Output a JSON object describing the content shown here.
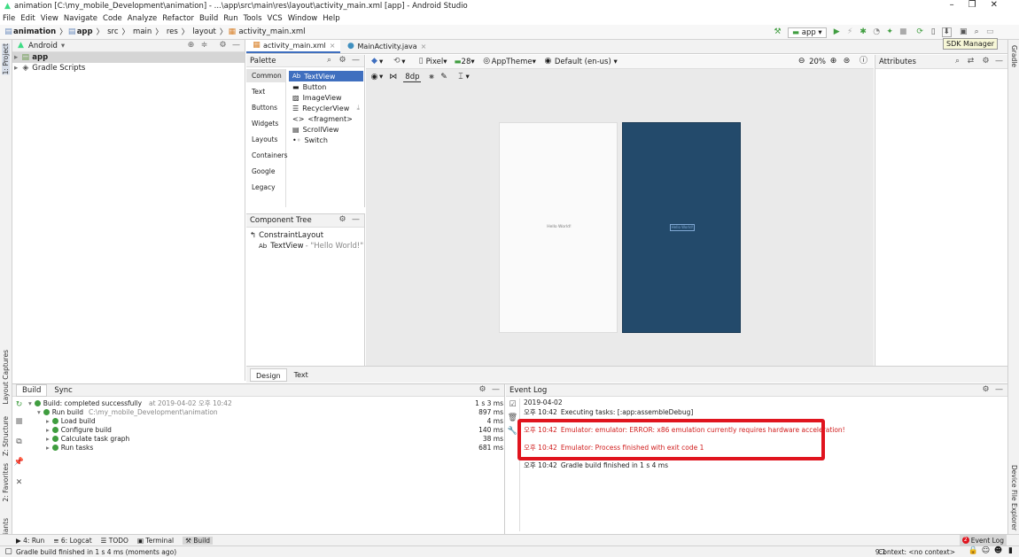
{
  "window": {
    "title": "animation [C:\\my_mobile_Development\\animation] - ...\\app\\src\\main\\res\\layout\\activity_main.xml [app] - Android Studio"
  },
  "menu": [
    "File",
    "Edit",
    "View",
    "Navigate",
    "Code",
    "Analyze",
    "Refactor",
    "Build",
    "Run",
    "Tools",
    "VCS",
    "Window",
    "Help"
  ],
  "breadcrumb": [
    "animation",
    "app",
    "src",
    "main",
    "res",
    "layout",
    "activity_main.xml"
  ],
  "toolbar": {
    "run_config": "app",
    "tooltip": "SDK Manager"
  },
  "project": {
    "view": "Android",
    "items": [
      "app",
      "Gradle Scripts"
    ]
  },
  "editor_tabs": [
    "activity_main.xml",
    "MainActivity.java"
  ],
  "palette": {
    "title": "Palette",
    "categories": [
      "Common",
      "Text",
      "Buttons",
      "Widgets",
      "Layouts",
      "Containers",
      "Google",
      "Legacy"
    ],
    "items": [
      "TextView",
      "Button",
      "ImageView",
      "RecyclerView",
      "<fragment>",
      "ScrollView",
      "Switch"
    ]
  },
  "design_toolbar": {
    "device": "Pixel",
    "api": "28",
    "theme": "AppTheme",
    "locale": "Default (en-us)",
    "zoom": "20%",
    "margin": "8dp"
  },
  "component_tree": {
    "title": "Component Tree",
    "root": "ConstraintLayout",
    "child": "TextView",
    "child_value": "- \"Hello World!\""
  },
  "preview": {
    "text": "Hello World!"
  },
  "attributes": {
    "title": "Attributes"
  },
  "design_tabs": [
    "Design",
    "Text"
  ],
  "build": {
    "tabs": [
      "Build",
      "Sync"
    ],
    "rows": [
      {
        "label": "Build: completed successfully",
        "detail": "at 2019-04-02 오후 10:42",
        "time": "1 s 3 ms"
      },
      {
        "label": "Run build",
        "detail": "C:\\my_mobile_Development\\animation",
        "time": "897 ms"
      },
      {
        "label": "Load build",
        "detail": "",
        "time": "4 ms"
      },
      {
        "label": "Configure build",
        "detail": "",
        "time": "140 ms"
      },
      {
        "label": "Calculate task graph",
        "detail": "",
        "time": "38 ms"
      },
      {
        "label": "Run tasks",
        "detail": "",
        "time": "681 ms"
      }
    ]
  },
  "eventlog": {
    "title": "Event Log",
    "date": "2019-04-02",
    "entries": [
      {
        "time": "오후 10:42",
        "text": "Executing tasks: [:app:assembleDebug]",
        "error": false
      },
      {
        "time": "오후 10:42",
        "text": "Emulator: emulator: ERROR: x86 emulation currently requires hardware acceleration!",
        "error": true
      },
      {
        "time": "오후 10:42",
        "text": "Emulator: Process finished with exit code 1",
        "error": true
      },
      {
        "time": "오후 10:42",
        "text": "Gradle build finished in 1 s 4 ms",
        "error": false
      }
    ]
  },
  "toolwindows": [
    "4: Run",
    "6: Logcat",
    "TODO",
    "Terminal",
    "Build"
  ],
  "eventlog_button": "Event Log",
  "eventlog_badge": "2",
  "side_left": [
    "1: Project",
    "Layout Captures",
    "Z: Structure",
    "2: Favorites",
    "Build Variants"
  ],
  "side_right": [
    "Gradle",
    "Device File Explorer"
  ],
  "status": {
    "message": "Gradle build finished in 1 s 4 ms (moments ago)",
    "position": "9:1",
    "context": "Context: <no context>"
  },
  "colors": {
    "accent": "#3f6fbf",
    "error": "#d01c1c",
    "highlight_box": "#e0141e",
    "blueprint": "#234a6b"
  }
}
